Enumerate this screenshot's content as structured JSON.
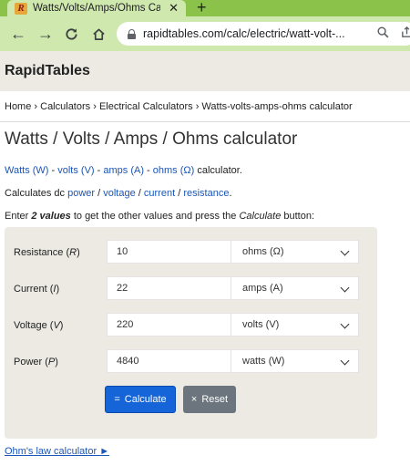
{
  "browser": {
    "tab_title": "Watts/Volts/Amps/Ohms Calcula",
    "tab_close": "✕",
    "new_tab": "+",
    "url": "rapidtables.com/calc/electric/watt-volt-...",
    "colors": {
      "tabstrip": "#8bc34a",
      "toolbar": "#cfe8ad"
    }
  },
  "site": {
    "logo": "RapidTables"
  },
  "breadcrumb": {
    "items": [
      "Home",
      "Calculators",
      "Electrical Calculators",
      "Watts-volts-amps-ohms calculator"
    ],
    "separator": " › "
  },
  "title": "Watts / Volts / Amps / Ohms calculator",
  "intro": {
    "links": [
      "Watts (W)",
      "volts (V)",
      "amps (A)",
      "ohms (Ω)"
    ],
    "sep": " - ",
    "suffix": " calculator."
  },
  "calculates": {
    "prefix": "Calculates dc ",
    "links": [
      "power",
      "voltage",
      "current",
      "resistance"
    ],
    "sep": " / ",
    "suffix": "."
  },
  "instruction": {
    "part1": "Enter ",
    "bold": "2 values",
    "part2": " to get the other values and press the ",
    "italic": "Calculate",
    "part3": " button:"
  },
  "calculator": {
    "rows": [
      {
        "label": "Resistance",
        "symbol": "R",
        "value": "10",
        "unit": "ohms (Ω)"
      },
      {
        "label": "Current",
        "symbol": "I",
        "value": "22",
        "unit": "amps (A)"
      },
      {
        "label": "Voltage",
        "symbol": "V",
        "value": "220",
        "unit": "volts (V)"
      },
      {
        "label": "Power",
        "symbol": "P",
        "value": "4840",
        "unit": "watts (W)"
      }
    ],
    "calculate_icon": "=",
    "calculate_label": "Calculate",
    "reset_icon": "×",
    "reset_label": "Reset",
    "colors": {
      "panel": "#eceae3",
      "calculate": "#1565d8",
      "reset": "#6c757d"
    }
  },
  "footer_link": {
    "label": "Ohm's law calculator",
    "arrow": "►"
  }
}
